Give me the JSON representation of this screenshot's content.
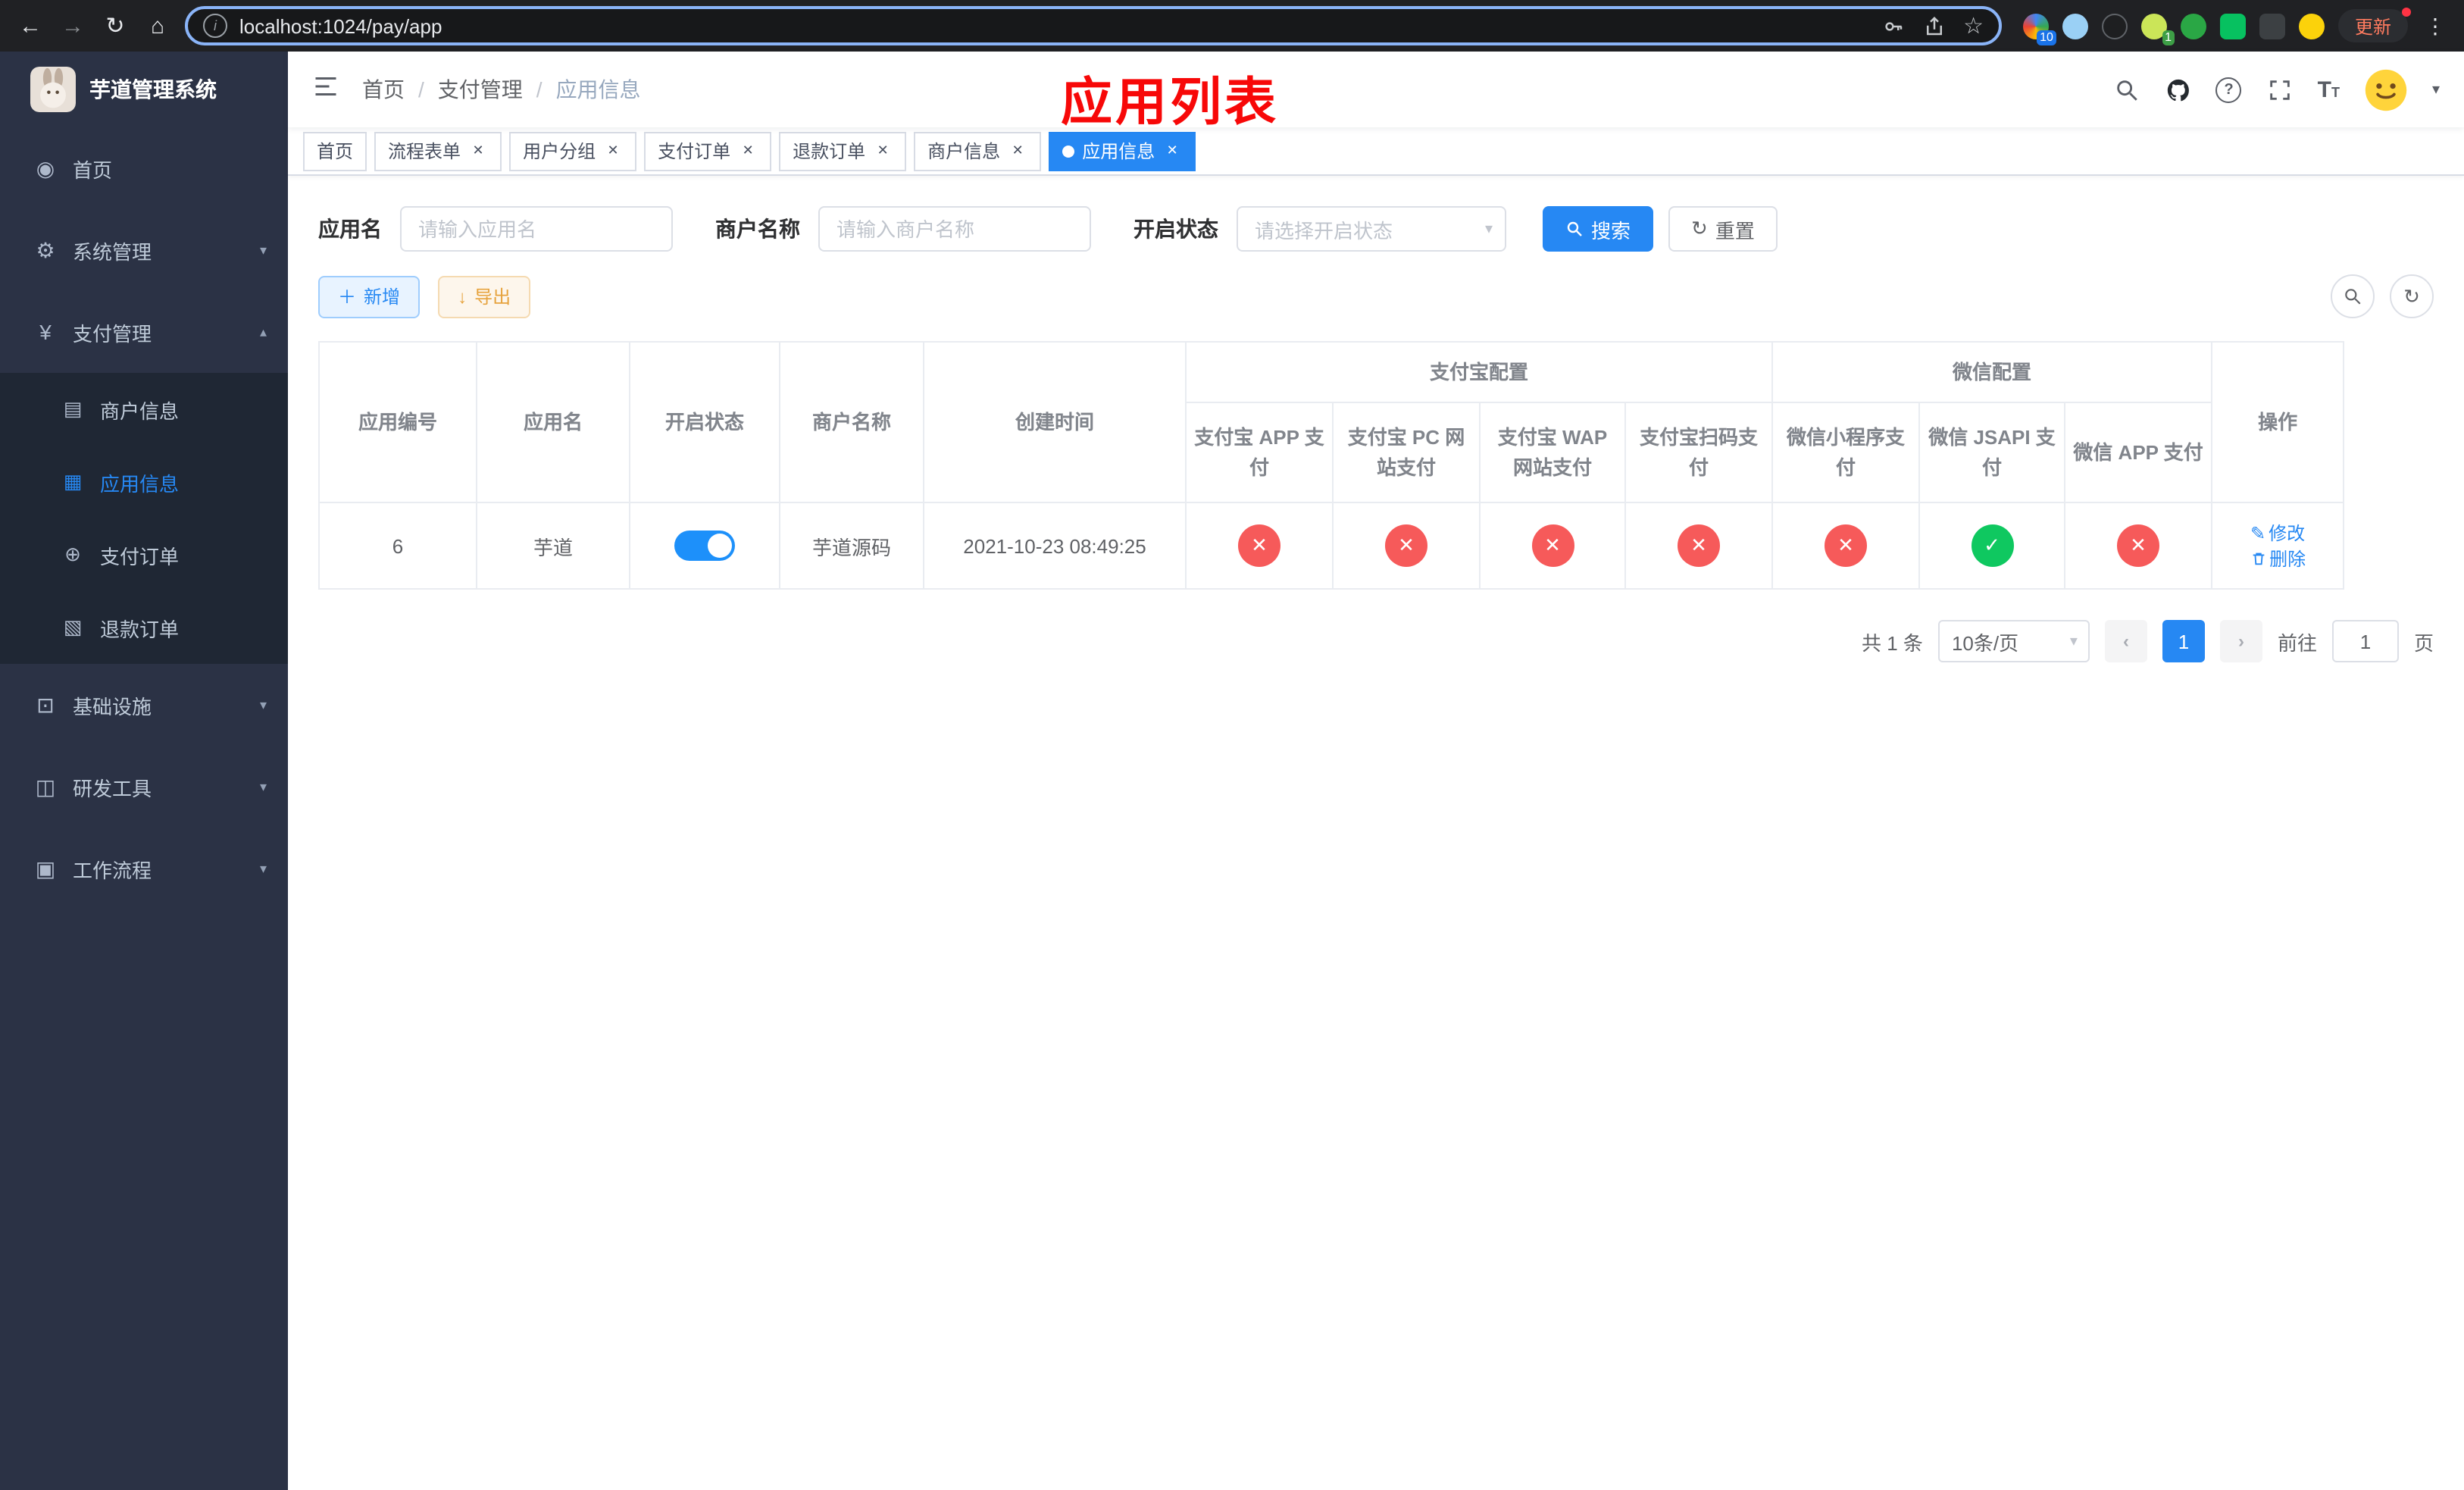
{
  "browser": {
    "url": "localhost:1024/pay/app",
    "update_label": "更新",
    "ext_badge_10": "10",
    "ext_badge_1": "1"
  },
  "app": {
    "title": "芋道管理系统",
    "annotation": "应用列表"
  },
  "sidebar": {
    "menu": [
      {
        "label": "首页"
      },
      {
        "label": "系统管理"
      },
      {
        "label": "支付管理"
      },
      {
        "label": "商户信息"
      },
      {
        "label": "应用信息"
      },
      {
        "label": "支付订单"
      },
      {
        "label": "退款订单"
      },
      {
        "label": "基础设施"
      },
      {
        "label": "研发工具"
      },
      {
        "label": "工作流程"
      }
    ]
  },
  "breadcrumb": {
    "items": [
      "首页",
      "支付管理",
      "应用信息"
    ]
  },
  "tabs": [
    {
      "label": "首页"
    },
    {
      "label": "流程表单"
    },
    {
      "label": "用户分组"
    },
    {
      "label": "支付订单"
    },
    {
      "label": "退款订单"
    },
    {
      "label": "商户信息"
    },
    {
      "label": "应用信息"
    }
  ],
  "filters": {
    "app_name_label": "应用名",
    "app_name_placeholder": "请输入应用名",
    "merchant_label": "商户名称",
    "merchant_placeholder": "请输入商户名称",
    "status_label": "开启状态",
    "status_placeholder": "请选择开启状态",
    "search_label": "搜索",
    "reset_label": "重置"
  },
  "toolbar": {
    "add_label": "新增",
    "export_label": "导出"
  },
  "table": {
    "headers": {
      "app_no": "应用编号",
      "app_name": "应用名",
      "status": "开启状态",
      "merchant": "商户名称",
      "created": "创建时间",
      "alipay_group": "支付宝配置",
      "wechat_group": "微信配置",
      "alipay_app": "支付宝 APP 支付",
      "alipay_pc": "支付宝 PC 网站支付",
      "alipay_wap": "支付宝 WAP 网站支付",
      "alipay_qr": "支付宝扫码支付",
      "wx_mini": "微信小程序支付",
      "wx_jsapi": "微信 JSAPI 支付",
      "wx_app": "微信 APP 支付",
      "ops": "操作"
    },
    "row": {
      "app_no": "6",
      "app_name": "芋道",
      "enabled": true,
      "merchant": "芋道源码",
      "created": "2021-10-23 08:49:25",
      "statuses": [
        "fail",
        "fail",
        "fail",
        "fail",
        "fail",
        "pass",
        "fail"
      ],
      "edit_label": "修改",
      "delete_label": "删除"
    }
  },
  "pagination": {
    "total_label": "共 1 条",
    "page_size": "10条/页",
    "current_page": "1",
    "goto_label": "前往",
    "goto_value": "1",
    "page_unit": "页"
  },
  "icons": {
    "pass": "✓",
    "fail": "✕"
  }
}
